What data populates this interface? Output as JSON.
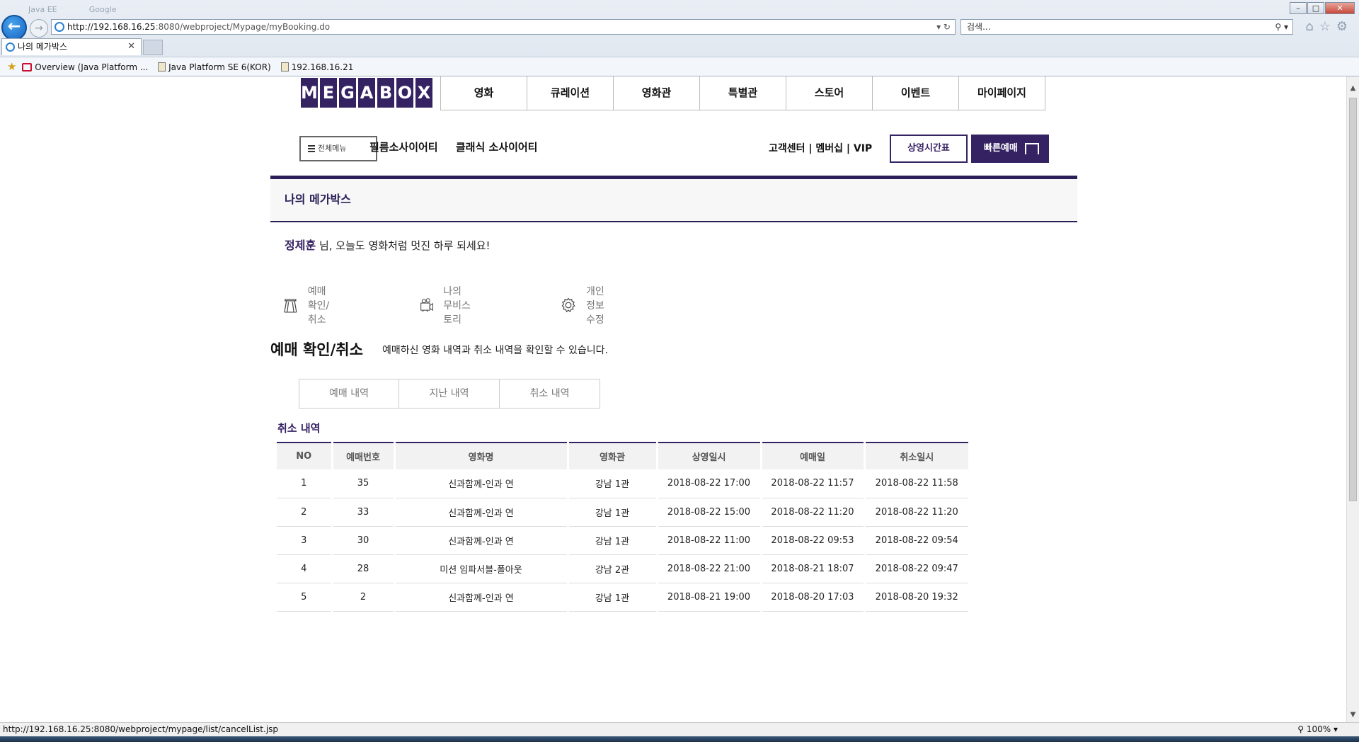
{
  "browser": {
    "ghost_tabs": [
      "Java EE",
      "Google"
    ],
    "url_host": "http://192.168.16.25",
    "url_rest": ":8080/webproject/Mypage/myBooking.do",
    "search_placeholder": "검색...",
    "tab_title": "나의 메가박스",
    "favorites": [
      "Overview (Java Platform ...",
      "Java Platform SE 6(KOR)",
      "192.168.16.21"
    ],
    "status_url": "http://192.168.16.25:8080/webproject/mypage/list/cancelList.jsp",
    "zoom": "100%"
  },
  "header": {
    "logo_letters": [
      "M",
      "E",
      "G",
      "A",
      "B",
      "O",
      "X"
    ],
    "gnb": [
      "영화",
      "큐레이션",
      "영화관",
      "특별관",
      "스토어",
      "이벤트",
      "마이페이지"
    ],
    "all_menu": "전체메뉴",
    "sub_links": [
      "필름소사이어티",
      "클래식 소사이어티"
    ],
    "util_links": "고객센터 | 멤버십 | VIP",
    "timetable_btn": "상영시간표",
    "quick_btn": "빠른예매"
  },
  "mypage": {
    "title": "나의 메가박스",
    "user_name": "정제훈",
    "greeting_rest": " 님, 오늘도 영화처럼 멋진 하루 되세요!",
    "menu": [
      {
        "label": "예매 확인/취소",
        "icon": "ticket-icon"
      },
      {
        "label": "나의 무비스토리",
        "icon": "camera-icon"
      },
      {
        "label": "개인정보수정",
        "icon": "gear-icon"
      }
    ]
  },
  "section": {
    "title": "예매 확인/취소",
    "description": "예매하신 영화 내역과 취소 내역을 확인할 수 있습니다.",
    "tabs": [
      "예매 내역",
      "지난 내역",
      "취소 내역"
    ],
    "list_title": "취소 내역"
  },
  "table": {
    "headers": [
      "NO",
      "예매번호",
      "영화명",
      "영화관",
      "상영일시",
      "예매일",
      "취소일시"
    ],
    "rows": [
      [
        "1",
        "35",
        "신과함께-인과 연",
        "강남 1관",
        "2018-08-22 17:00",
        "2018-08-22 11:57",
        "2018-08-22 11:58"
      ],
      [
        "2",
        "33",
        "신과함께-인과 연",
        "강남 1관",
        "2018-08-22 15:00",
        "2018-08-22 11:20",
        "2018-08-22 11:20"
      ],
      [
        "3",
        "30",
        "신과함께-인과 연",
        "강남 1관",
        "2018-08-22 11:00",
        "2018-08-22 09:53",
        "2018-08-22 09:54"
      ],
      [
        "4",
        "28",
        "미션 임파서블-폴아웃",
        "강남 2관",
        "2018-08-22 21:00",
        "2018-08-21 18:07",
        "2018-08-22 09:47"
      ],
      [
        "5",
        "2",
        "신과함께-인과 연",
        "강남 1관",
        "2018-08-21 19:00",
        "2018-08-20 17:03",
        "2018-08-20 19:32"
      ]
    ]
  },
  "colors": {
    "brand": "#352263",
    "border_dark": "#2a1f57"
  }
}
